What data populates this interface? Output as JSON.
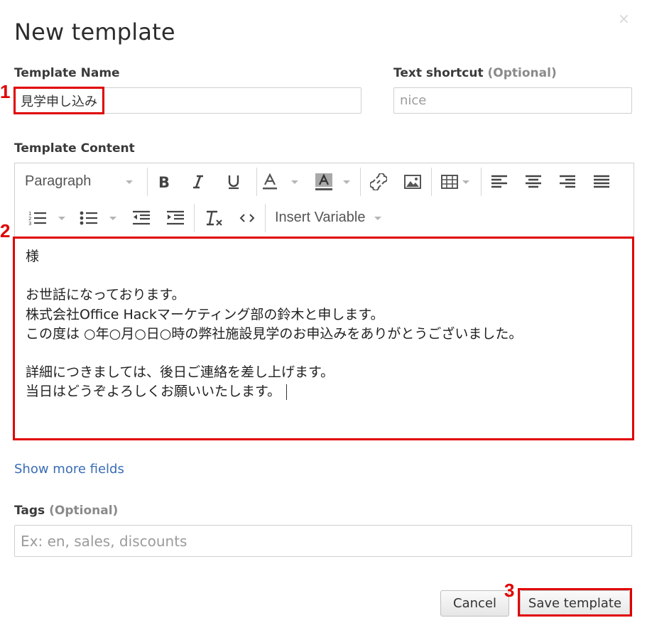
{
  "dialog": {
    "title": "New template",
    "close_glyph": "×"
  },
  "template_name": {
    "label": "Template Name",
    "value": "見学申し込み"
  },
  "text_shortcut": {
    "label": "Text shortcut",
    "optional": "(Optional)",
    "placeholder": "nice"
  },
  "template_content": {
    "label": "Template Content",
    "toolbar": {
      "format_select": "Paragraph",
      "insert_variable": "Insert Variable"
    },
    "lines": [
      "様",
      "",
      "お世話になっております。",
      "株式会社Office Hackマーケティング部の鈴木と申します。",
      "この度は ○年○月○日○時の弊社施設見学のお申込みをありがとうございました。",
      "",
      "詳細につきましては、後日ご連絡を差し上げます。",
      "当日はどうぞよろしくお願いいたします。"
    ]
  },
  "show_more": "Show more fields",
  "tags": {
    "label": "Tags",
    "optional": "(Optional)",
    "placeholder": "Ex: en, sales, discounts"
  },
  "buttons": {
    "cancel": "Cancel",
    "save": "Save template"
  },
  "annotations": {
    "step1": "1",
    "step2": "2",
    "step3": "3"
  },
  "colors": {
    "highlight": "#e00000",
    "link": "#3a6db5"
  }
}
